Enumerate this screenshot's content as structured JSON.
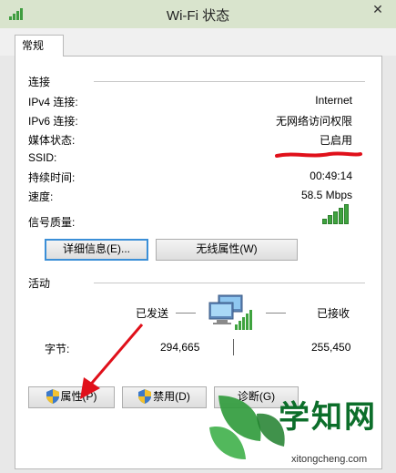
{
  "window": {
    "title": "Wi-Fi 状态",
    "close_glyph": "✕",
    "title_icon": "wifi-signal-icon"
  },
  "tabs": [
    {
      "label": "常规"
    }
  ],
  "connection": {
    "section_title": "连接",
    "rows": [
      {
        "label": "IPv4 连接:",
        "value": "Internet"
      },
      {
        "label": "IPv6 连接:",
        "value": "无网络访问权限"
      },
      {
        "label": "媒体状态:",
        "value": "已启用"
      },
      {
        "label": "SSID:",
        "value": ""
      },
      {
        "label": "持续时间:",
        "value": "00:49:14"
      },
      {
        "label": "速度:",
        "value": "58.5 Mbps"
      },
      {
        "label": "信号质量:",
        "value": ""
      }
    ],
    "signal_bars_filled": 5,
    "signal_bars_total": 5,
    "details_button": "详细信息(E)...",
    "wireless_properties_button": "无线属性(W)"
  },
  "activity": {
    "section_title": "活动",
    "sent_label": "已发送",
    "received_label": "已接收",
    "bytes_label": "字节:",
    "bytes_sent": "294,665",
    "bytes_received": "255,450",
    "network_icon": "network-computers-icon"
  },
  "buttons": {
    "properties": "属性(P)",
    "disable": "禁用(D)",
    "diagnose": "诊断(G)"
  },
  "watermark": {
    "brand": "学知网",
    "url": "xitongcheng.com"
  },
  "colors": {
    "titlebar": "#d9e4cd",
    "signal": "#3fa33f",
    "annotation_red": "#e0101a",
    "focus": "#3b8fd7"
  }
}
